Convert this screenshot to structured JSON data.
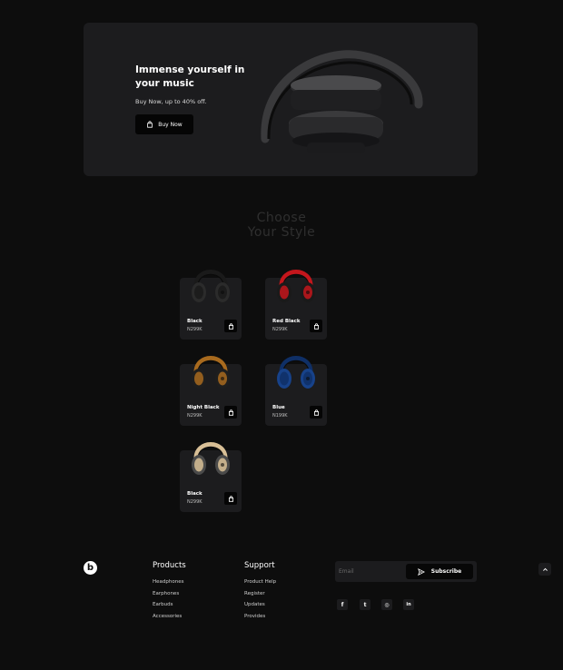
{
  "hero": {
    "title": "Immense yourself in your music",
    "subtitle": "Buy Now, up to 40% off.",
    "button_label": "Buy Now",
    "button_icon": "shopping-bag-icon"
  },
  "section": {
    "title_line1": "Choose",
    "title_line2": "Your Style"
  },
  "products": [
    {
      "name": "Black",
      "price": "N299K",
      "color": "#1a1a1a",
      "accent": "#2b2b2b",
      "icon": "shopping-bag-icon"
    },
    {
      "name": "Red Black",
      "price": "N299K",
      "color": "#c4161c",
      "accent": "#1a1a1a",
      "icon": "shopping-bag-icon"
    },
    {
      "name": "Night Black",
      "price": "N299K",
      "color": "#a86a1e",
      "accent": "#1e1e1e",
      "icon": "shopping-bag-icon"
    },
    {
      "name": "Blue",
      "price": "N199K",
      "color": "#0f2f66",
      "accent": "#17428a",
      "icon": "shopping-bag-icon"
    },
    {
      "name": "Black",
      "price": "N299K",
      "color": "#d8bf96",
      "accent": "#4a4a4a",
      "icon": "shopping-bag-icon"
    }
  ],
  "footer": {
    "logo_letter": "b",
    "products": {
      "heading": "Products",
      "links": [
        "Headphones",
        "Earphones",
        "Earbuds",
        "Accessories"
      ]
    },
    "support": {
      "heading": "Support",
      "links": [
        "Product Help",
        "Register",
        "Updates",
        "Provides"
      ]
    },
    "newsletter": {
      "placeholder": "Email",
      "button_label": "Subscribe",
      "button_icon": "send-icon"
    },
    "social": [
      {
        "icon": "facebook-icon",
        "glyph": "f"
      },
      {
        "icon": "twitter-icon",
        "glyph": "t"
      },
      {
        "icon": "instagram-icon",
        "glyph": "◎"
      },
      {
        "icon": "linkedin-icon",
        "glyph": "in"
      }
    ],
    "back_to_top_icon": "chevron-up-icon"
  }
}
